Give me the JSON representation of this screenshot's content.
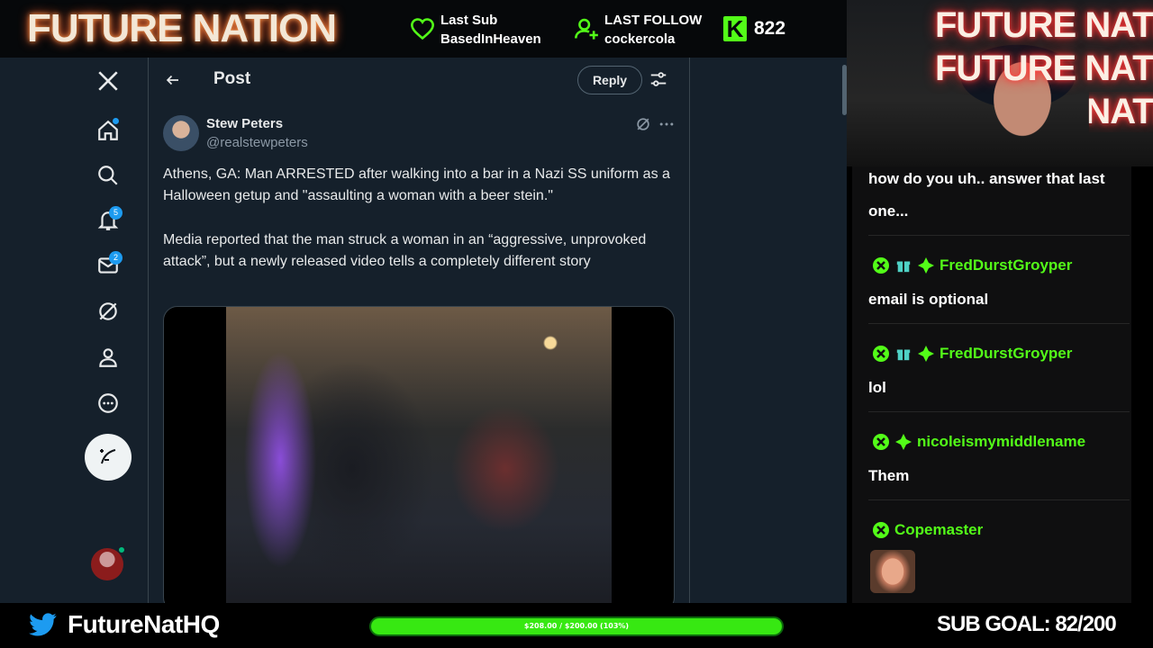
{
  "overlay": {
    "brand": "FUTURE NATION",
    "last_sub": {
      "label": "Last Sub",
      "name": "BasedInHeaven"
    },
    "last_follow": {
      "label": "LAST FOLLOW",
      "name": "cockercola"
    },
    "kick_followers": "822",
    "accent": "#53fc18"
  },
  "x_app": {
    "nav": {
      "notifications_badge": "5",
      "messages_badge": "2"
    },
    "header": {
      "title": "Post",
      "reply_label": "Reply"
    },
    "post": {
      "author_name": "Stew Peters",
      "author_handle": "@realstewpeters",
      "paragraph_1": "Athens, GA: Man ARRESTED after walking into a bar in a Nazi SS uniform as a Halloween getup and \"assaulting a woman with a beer stein.\"",
      "paragraph_2": "Media reported that the man struck a woman in an “aggressive, unprovoked attack”, but a newly released video tells a completely different story"
    },
    "colors": {
      "background": "#15202b",
      "border": "#38444d",
      "link": "#1d9bf0"
    }
  },
  "webcam": {
    "neon_lines": [
      "FUTURE NATION",
      "FUTURE NATION",
      "FUTURE NATION"
    ]
  },
  "chat": {
    "messages": [
      {
        "text": "how do you uh.. answer that last one..."
      },
      {
        "user": "FredDurstGroyper",
        "text": "email is optional"
      },
      {
        "user": "FredDurstGroyper",
        "text": "lol"
      },
      {
        "user": "nicoleismymiddlename",
        "text": "Them"
      },
      {
        "user": "Copemaster",
        "text": ""
      }
    ]
  },
  "bottom": {
    "twitter_handle": "FutureNatHQ",
    "goal_progress_label": "$208.00 / $200.00 (103%)",
    "goal_progress_fraction": 1.0,
    "sub_goal": "SUB GOAL: 82/200"
  }
}
